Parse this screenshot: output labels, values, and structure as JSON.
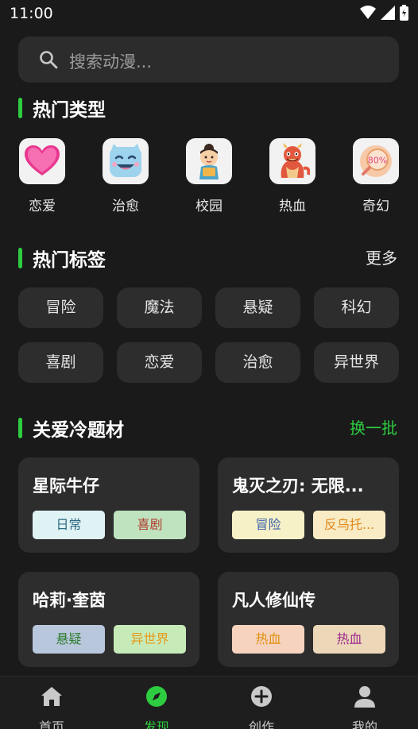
{
  "status_bar": {
    "time": "11:00"
  },
  "search": {
    "placeholder": "搜索动漫..."
  },
  "hot_categories": {
    "title": "热门类型",
    "items": [
      {
        "label": "恋爱",
        "icon": "heart-icon"
      },
      {
        "label": "治愈",
        "icon": "smiling-face-icon"
      },
      {
        "label": "校园",
        "icon": "student-icon"
      },
      {
        "label": "热血",
        "icon": "dragon-icon"
      },
      {
        "label": "奇幻",
        "icon": "magnifier-80-icon",
        "icon_text": "80%"
      }
    ]
  },
  "hot_tags": {
    "title": "热门标签",
    "more_label": "更多",
    "tags": [
      "冒险",
      "魔法",
      "悬疑",
      "科幻",
      "喜剧",
      "恋爱",
      "治愈",
      "异世界"
    ]
  },
  "niche": {
    "title": "关爱冷题材",
    "refresh_label": "换一批",
    "cards": [
      {
        "title": "星际牛仔",
        "tags": [
          {
            "label": "日常",
            "bg": "#dff3f5",
            "fg": "#2f6a80"
          },
          {
            "label": "喜剧",
            "bg": "#bfe3bf",
            "fg": "#b03a2e"
          }
        ]
      },
      {
        "title": "鬼灭之刃: 无限...",
        "tags": [
          {
            "label": "冒险",
            "bg": "#f7f1c8",
            "fg": "#3a5fa8"
          },
          {
            "label": "反乌托...",
            "bg": "#f9ebc4",
            "fg": "#e08a1e"
          }
        ]
      },
      {
        "title": "哈莉·奎茵",
        "tags": [
          {
            "label": "悬疑",
            "bg": "#b9c7dc",
            "fg": "#2e7d32"
          },
          {
            "label": "异世界",
            "bg": "#c7ebb8",
            "fg": "#e69a1a"
          }
        ]
      },
      {
        "title": "凡人修仙传",
        "tags": [
          {
            "label": "热血",
            "bg": "#f5d3bf",
            "fg": "#e0900e"
          },
          {
            "label": "热血",
            "bg": "#ecd7b8",
            "fg": "#9c2a8c"
          }
        ]
      }
    ]
  },
  "tabbar": {
    "tabs": [
      {
        "label": "首页",
        "icon": "home-icon"
      },
      {
        "label": "发现",
        "icon": "compass-icon",
        "active": true
      },
      {
        "label": "创作",
        "icon": "plus-circle-icon"
      },
      {
        "label": "我的",
        "icon": "person-icon"
      }
    ]
  },
  "colors": {
    "accent": "#2ecc40",
    "background": "#1a1a1a",
    "card": "#2d2d2d"
  }
}
